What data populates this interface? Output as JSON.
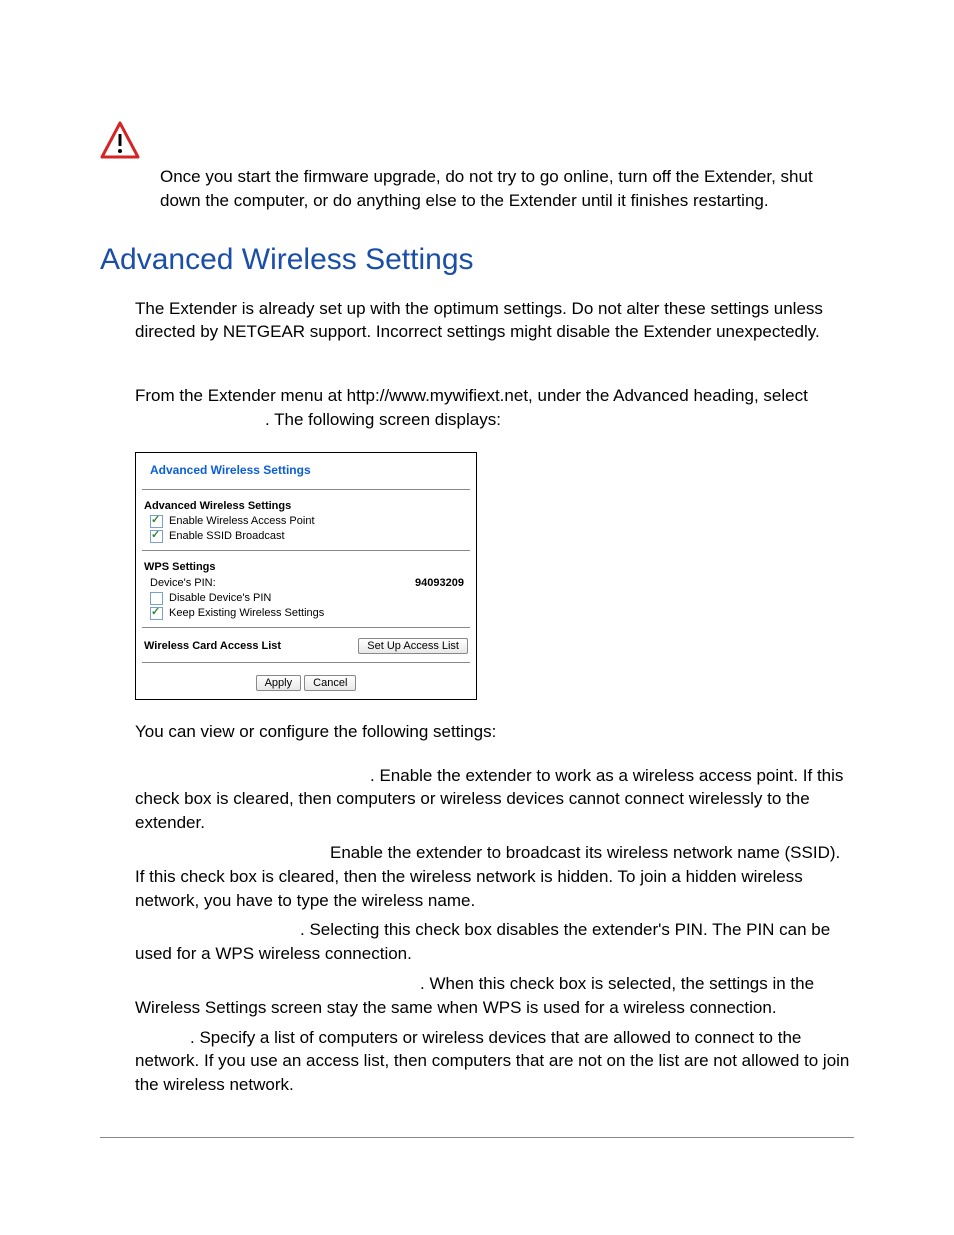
{
  "warning": {
    "text": "Once you start the firmware upgrade, do not try to go online, turn off the Extender, shut down the computer, or do anything else to the Extender until it finishes restarting."
  },
  "section": {
    "heading": "Advanced Wireless Settings",
    "intro": "The Extender is already set up with the optimum settings. Do not alter these settings unless directed by NETGEAR support. Incorrect settings might disable the Extender unexpectedly.",
    "nav_line_1": "From the Extender menu at http://www.mywifiext.net, under the Advanced heading, select",
    "nav_line_2": ". The following screen displays:"
  },
  "panel": {
    "title": "Advanced Wireless Settings",
    "adv_label": "Advanced Wireless Settings",
    "cb_enable_ap": "Enable Wireless Access Point",
    "cb_enable_ssid": "Enable SSID Broadcast",
    "wps_label": "WPS Settings",
    "pin_label": "Device's PIN:",
    "pin_value": "94093209",
    "cb_disable_pin": "Disable Device's PIN",
    "cb_keep_existing": "Keep Existing Wireless Settings",
    "access_label": "Wireless Card Access List",
    "access_btn": "Set Up Access List",
    "apply": "Apply",
    "cancel": "Cancel"
  },
  "settings_intro": "You can view or configure the following settings:",
  "settings": {
    "d1": ". Enable the extender to work as a wireless access point. If this check box is cleared, then computers or wireless devices cannot connect wirelessly to the extender.",
    "d2": "Enable the extender to broadcast its wireless network name (SSID). If this check box is cleared, then the wireless network is hidden. To join a hidden wireless network, you have to type the wireless name.",
    "d3": ". Selecting this check box disables the extender's PIN. The PIN can be used for a WPS wireless connection.",
    "d4": ". When this check box is selected, the settings in the Wireless Settings screen stay the same when WPS is used for a wireless connection.",
    "d5": ". Specify a list of computers or wireless devices that are allowed to connect to the network. If you use an access list, then computers that are not on the list are not allowed to join the wireless network."
  }
}
